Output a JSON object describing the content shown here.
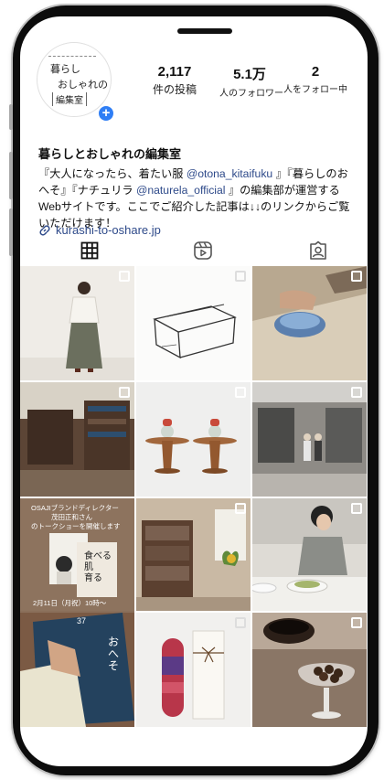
{
  "profile": {
    "avatar_logo": [
      "暮らし",
      "おしゃれの",
      "編集室"
    ],
    "stats": {
      "posts": {
        "value": "2,117",
        "label": "件の投稿"
      },
      "followers": {
        "value": "5.1万",
        "label": "人のフォロワー"
      },
      "following": {
        "value": "2",
        "label": "人をフォロー中"
      }
    },
    "name": "暮らしとおしゃれの編集室",
    "bio": {
      "p1": "『大人になったら、着たい服 ",
      "m1": "@otona_kitaifuku",
      "p2": " 』『暮らしのおへそ』『ナチュリラ ",
      "m2": "@naturela_official",
      "p3": " 』の編集部が運営するWebサイトです。ここでご紹介した記事は↓↓のリンクからご覧いただけます！"
    },
    "link": "kurashi-to-oshare.jp"
  },
  "tabs": [
    {
      "name": "grid",
      "icon": "grid-icon"
    },
    {
      "name": "reels",
      "icon": "reels-icon"
    },
    {
      "name": "tagged",
      "icon": "tagged-icon"
    }
  ],
  "posts": {
    "p7_text": [
      "OSAJIブランドディレクター",
      "茂田正和さん",
      "のトークショーを開催します"
    ],
    "p7_date": "2月11日（月祝）10時〜",
    "p7_book": [
      "食べる",
      "肌",
      "育る"
    ],
    "p10_book": "おへそ",
    "p10_issue": "37"
  },
  "colors": {
    "link": "#2e4a8a",
    "badge": "#2f7ef5"
  }
}
